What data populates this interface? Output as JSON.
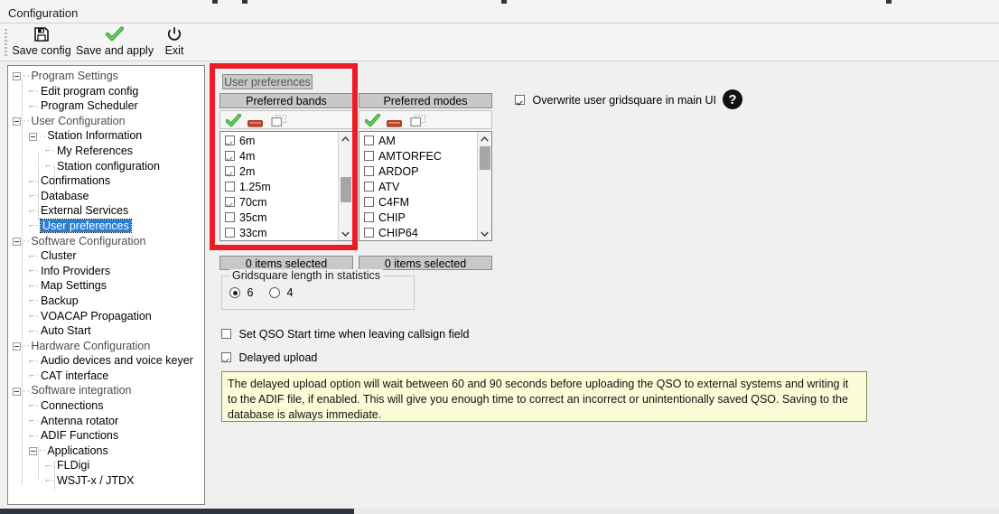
{
  "window": {
    "title": "Configuration"
  },
  "toolbar": {
    "buttons": [
      {
        "label": "Save config",
        "icon": "floppy-disk-icon"
      },
      {
        "label": "Save and apply",
        "icon": "green-check-icon"
      },
      {
        "label": "Exit",
        "icon": "power-icon"
      }
    ]
  },
  "tree": {
    "nodes": [
      {
        "label": "Program Settings",
        "depth": 0,
        "expander": true,
        "group": true
      },
      {
        "label": "Edit program config",
        "depth": 1,
        "expander": false,
        "group": false
      },
      {
        "label": "Program Scheduler",
        "depth": 1,
        "expander": false,
        "group": false
      },
      {
        "label": "User Configuration",
        "depth": 0,
        "expander": true,
        "group": true
      },
      {
        "label": "Station Information",
        "depth": 1,
        "expander": true,
        "group": false
      },
      {
        "label": "My References",
        "depth": 2,
        "expander": false,
        "group": false
      },
      {
        "label": "Station configuration",
        "depth": 2,
        "expander": false,
        "group": false
      },
      {
        "label": "Confirmations",
        "depth": 1,
        "expander": false,
        "group": false
      },
      {
        "label": "Database",
        "depth": 1,
        "expander": false,
        "group": false
      },
      {
        "label": "External Services",
        "depth": 1,
        "expander": false,
        "group": false
      },
      {
        "label": "User preferences",
        "depth": 1,
        "expander": false,
        "group": false,
        "selected": true
      },
      {
        "label": "Software Configuration",
        "depth": 0,
        "expander": true,
        "group": true
      },
      {
        "label": "Cluster",
        "depth": 1,
        "expander": false,
        "group": false
      },
      {
        "label": "Info Providers",
        "depth": 1,
        "expander": false,
        "group": false
      },
      {
        "label": "Map Settings",
        "depth": 1,
        "expander": false,
        "group": false
      },
      {
        "label": "Backup",
        "depth": 1,
        "expander": false,
        "group": false
      },
      {
        "label": "VOACAP Propagation",
        "depth": 1,
        "expander": false,
        "group": false
      },
      {
        "label": "Auto Start",
        "depth": 1,
        "expander": false,
        "group": false
      },
      {
        "label": "Hardware Configuration",
        "depth": 0,
        "expander": true,
        "group": true
      },
      {
        "label": "Audio devices and voice keyer",
        "depth": 1,
        "expander": false,
        "group": false
      },
      {
        "label": "CAT interface",
        "depth": 1,
        "expander": false,
        "group": false
      },
      {
        "label": "Software integration",
        "depth": 0,
        "expander": true,
        "group": true
      },
      {
        "label": "Connections",
        "depth": 1,
        "expander": false,
        "group": false
      },
      {
        "label": "Antenna rotator",
        "depth": 1,
        "expander": false,
        "group": false
      },
      {
        "label": "ADIF Functions",
        "depth": 1,
        "expander": false,
        "group": false
      },
      {
        "label": "Applications",
        "depth": 1,
        "expander": true,
        "group": false
      },
      {
        "label": "FLDigi",
        "depth": 2,
        "expander": false,
        "group": false
      },
      {
        "label": "WSJT-x / JTDX",
        "depth": 2,
        "expander": false,
        "group": false
      }
    ]
  },
  "page": {
    "tab_label": "User preferences"
  },
  "bands": {
    "header": "Preferred bands",
    "tools": [
      {
        "name": "select-all-icon",
        "glyph": "check"
      },
      {
        "name": "deselect-all-icon",
        "glyph": "minus"
      },
      {
        "name": "copy-icon",
        "glyph": "copy",
        "disabled": true
      }
    ],
    "items": [
      {
        "label": "6m",
        "checked": true
      },
      {
        "label": "4m",
        "checked": true
      },
      {
        "label": "2m",
        "checked": true
      },
      {
        "label": "1.25m",
        "checked": false
      },
      {
        "label": "70cm",
        "checked": true
      },
      {
        "label": "35cm",
        "checked": false
      },
      {
        "label": "33cm",
        "checked": false
      }
    ],
    "status": "0 items selected"
  },
  "modes": {
    "header": "Preferred modes",
    "tools": [
      {
        "name": "select-all-icon",
        "glyph": "check"
      },
      {
        "name": "deselect-all-icon",
        "glyph": "minus"
      },
      {
        "name": "copy-icon",
        "glyph": "copy",
        "disabled": true
      }
    ],
    "items": [
      {
        "label": "AM",
        "checked": false
      },
      {
        "label": "AMTORFEC",
        "checked": false
      },
      {
        "label": "ARDOP",
        "checked": false
      },
      {
        "label": "ATV",
        "checked": false
      },
      {
        "label": "C4FM",
        "checked": false
      },
      {
        "label": "CHIP",
        "checked": false
      },
      {
        "label": "CHIP64",
        "checked": false
      }
    ],
    "status": "0 items selected"
  },
  "overwrite_gridsquare": {
    "label": "Overwrite user gridsquare in main UI",
    "checked": true
  },
  "help_button": {
    "glyph": "?"
  },
  "gridsquare_group": {
    "title": "Gridsquare length in statistics",
    "options": [
      {
        "label": "6",
        "selected": true
      },
      {
        "label": "4",
        "selected": false
      }
    ]
  },
  "options": [
    {
      "label": "Set QSO Start time when leaving callsign field",
      "checked": false
    },
    {
      "label": "Delayed upload",
      "checked": true
    }
  ],
  "info_note": {
    "text": "The delayed upload option will wait between 60 and 90 seconds before uploading the QSO to external systems and writing it to the ADIF file, if enabled. This will give you enough time to correct an incorrect or unintentionally saved QSO. Saving to the database is always immediate."
  },
  "colors": {
    "annotation": "#ed1c24",
    "selection": "#2a7fd4",
    "note_bg": "#fcfbd8",
    "accent_green": "#3fae3f",
    "accent_red": "#d43a1e"
  }
}
